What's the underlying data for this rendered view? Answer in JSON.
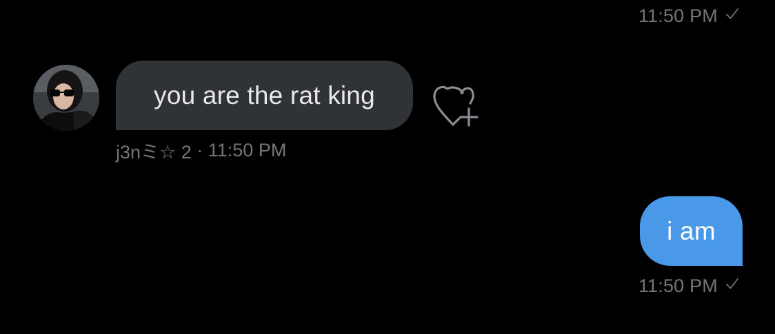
{
  "conversation": {
    "top_message_time": "11:50 PM",
    "top_message_status_icon": "checkmark-icon",
    "incoming": {
      "text": "you are the rat king",
      "sender_name": "j3nミ☆ 2",
      "separator": " · ",
      "time": "11:50 PM",
      "avatar_icon": "user-avatar-photo",
      "reaction_icon": "add-reaction-heart-icon"
    },
    "outgoing": {
      "text": "i am",
      "time": "11:50 PM",
      "status_icon": "checkmark-icon"
    }
  },
  "colors": {
    "background": "#000000",
    "incoming_bubble": "#2f3336",
    "outgoing_bubble": "#4a99e9",
    "meta_text": "#71767b",
    "incoming_text": "#e7e9ea",
    "outgoing_text": "#ffffff"
  }
}
